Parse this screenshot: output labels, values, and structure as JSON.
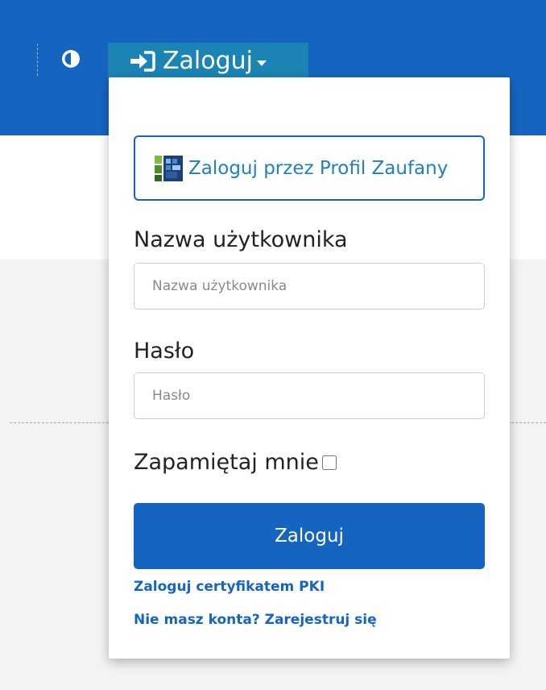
{
  "header": {
    "login_toggle_label": "Zaloguj",
    "contrast_icon": "contrast-icon",
    "login_icon": "sign-in-icon"
  },
  "login_dropdown": {
    "profil_zaufany_label": "Zaloguj przez Profil Zaufany",
    "username": {
      "label": "Nazwa użytkownika",
      "placeholder": "Nazwa użytkownika",
      "value": ""
    },
    "password": {
      "label": "Hasło",
      "placeholder": "Hasło",
      "value": ""
    },
    "remember_me_label": "Zapamiętaj mnie",
    "remember_me_checked": false,
    "submit_label": "Zaloguj",
    "pki_link": "Zaloguj certyfikatem PKI",
    "register_link": "Nie masz konta? Zarejestruj się"
  },
  "colors": {
    "primary": "#1565c0",
    "toggle_background": "#1b84b5",
    "link": "#1565c0"
  }
}
